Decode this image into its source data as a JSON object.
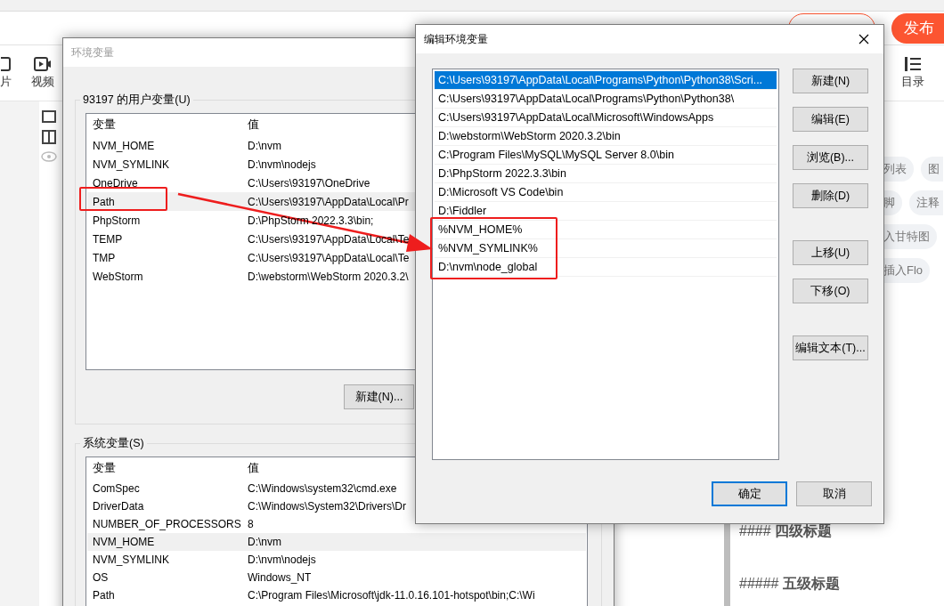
{
  "editor": {
    "publish_button": "发布",
    "toolbar": [
      {
        "label": "片",
        "kind": "image"
      },
      {
        "label": "视频",
        "kind": "video"
      }
    ],
    "outline_button": "目录",
    "tag_rows": [
      [
        "列表",
        "图"
      ],
      [
        "脚",
        "注释"
      ],
      [
        "入甘特图"
      ],
      [
        "插入Flo"
      ]
    ],
    "headings": [
      "#### **四级标题**",
      "##### **五级标题**"
    ]
  },
  "env_dialog": {
    "title": "环境变量",
    "user_group": {
      "label": "93197 的用户变量(U)",
      "columns": [
        "变量",
        "值"
      ],
      "rows": [
        {
          "name": "NVM_HOME",
          "value": "D:\\nvm",
          "selected": false
        },
        {
          "name": "NVM_SYMLINK",
          "value": "D:\\nvm\\nodejs",
          "selected": false
        },
        {
          "name": "OneDrive",
          "value": "C:\\Users\\93197\\OneDrive",
          "selected": false
        },
        {
          "name": "Path",
          "value": "C:\\Users\\93197\\AppData\\Local\\Pr",
          "selected": true
        },
        {
          "name": "PhpStorm",
          "value": "D:\\PhpStorm 2022.3.3\\bin;",
          "selected": false
        },
        {
          "name": "TEMP",
          "value": "C:\\Users\\93197\\AppData\\Local\\Te",
          "selected": false
        },
        {
          "name": "TMP",
          "value": "C:\\Users\\93197\\AppData\\Local\\Te",
          "selected": false
        },
        {
          "name": "WebStorm",
          "value": "D:\\webstorm\\WebStorm 2020.3.2\\",
          "selected": false
        }
      ],
      "buttons": [
        "新建(N)..."
      ]
    },
    "system_group": {
      "label": "系统变量(S)",
      "columns": [
        "变量",
        "值"
      ],
      "rows": [
        {
          "name": "ComSpec",
          "value": "C:\\Windows\\system32\\cmd.exe",
          "selected": false
        },
        {
          "name": "DriverData",
          "value": "C:\\Windows\\System32\\Drivers\\Dr",
          "selected": false
        },
        {
          "name": "NUMBER_OF_PROCESSORS",
          "value": "8",
          "selected": false
        },
        {
          "name": "NVM_HOME",
          "value": "D:\\nvm",
          "selected": true
        },
        {
          "name": "NVM_SYMLINK",
          "value": "D:\\nvm\\nodejs",
          "selected": false
        },
        {
          "name": "OS",
          "value": "Windows_NT",
          "selected": false
        },
        {
          "name": "Path",
          "value": "C:\\Program Files\\Microsoft\\jdk-11.0.16.101-hotspot\\bin;C:\\Wi",
          "selected": false
        }
      ]
    }
  },
  "edit_dialog": {
    "title": "编辑环境变量",
    "entries": [
      {
        "text": "C:\\Users\\93197\\AppData\\Local\\Programs\\Python\\Python38\\Scri...",
        "selected": true
      },
      {
        "text": "C:\\Users\\93197\\AppData\\Local\\Programs\\Python\\Python38\\",
        "selected": false
      },
      {
        "text": "C:\\Users\\93197\\AppData\\Local\\Microsoft\\WindowsApps",
        "selected": false
      },
      {
        "text": "D:\\webstorm\\WebStorm 2020.3.2\\bin",
        "selected": false
      },
      {
        "text": "C:\\Program Files\\MySQL\\MySQL Server 8.0\\bin",
        "selected": false
      },
      {
        "text": "D:\\PhpStorm 2022.3.3\\bin",
        "selected": false
      },
      {
        "text": "D:\\Microsoft VS Code\\bin",
        "selected": false
      },
      {
        "text": "D:\\Fiddler",
        "selected": false
      },
      {
        "text": "%NVM_HOME%",
        "selected": false
      },
      {
        "text": "%NVM_SYMLINK%",
        "selected": false
      },
      {
        "text": "D:\\nvm\\node_global",
        "selected": false
      }
    ],
    "button_groups": [
      [
        "新建(N)",
        "编辑(E)",
        "浏览(B)...",
        "删除(D)"
      ],
      [
        "上移(U)",
        "下移(O)"
      ],
      [
        "编辑文本(T)..."
      ]
    ],
    "ok_button": "确定",
    "cancel_button": "取消"
  }
}
